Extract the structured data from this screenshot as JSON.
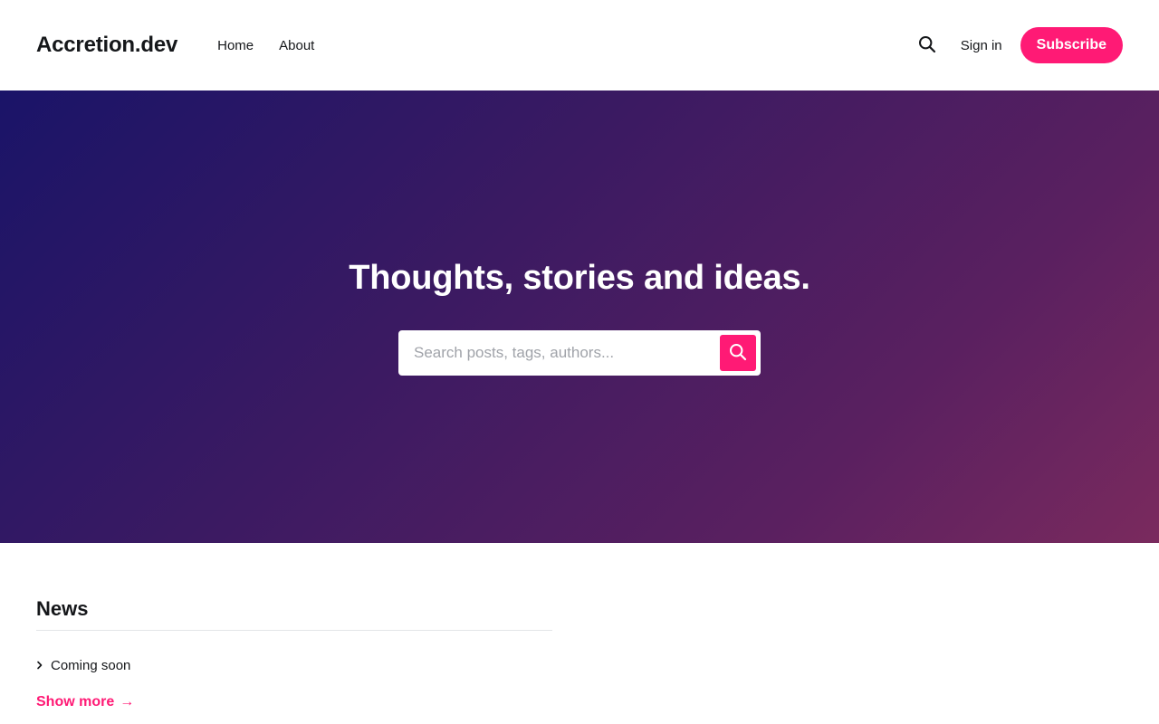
{
  "header": {
    "brand": "Accretion.dev",
    "nav": [
      {
        "label": "Home"
      },
      {
        "label": "About"
      }
    ],
    "search_icon": "search-icon",
    "signin_label": "Sign in",
    "subscribe_label": "Subscribe"
  },
  "hero": {
    "title": "Thoughts, stories and ideas.",
    "search": {
      "placeholder": "Search posts, tags, authors...",
      "value": "",
      "submit_icon": "search-icon"
    }
  },
  "news": {
    "title": "News",
    "items": [
      {
        "label": "Coming soon",
        "icon": "chevron-right-icon"
      }
    ],
    "show_more_label": "Show more",
    "show_more_arrow": "→"
  },
  "colors": {
    "accent": "#ff1a75",
    "text": "#15171a",
    "hero_gradient_start": "#1a1468",
    "hero_gradient_end": "#7a2a5e"
  }
}
